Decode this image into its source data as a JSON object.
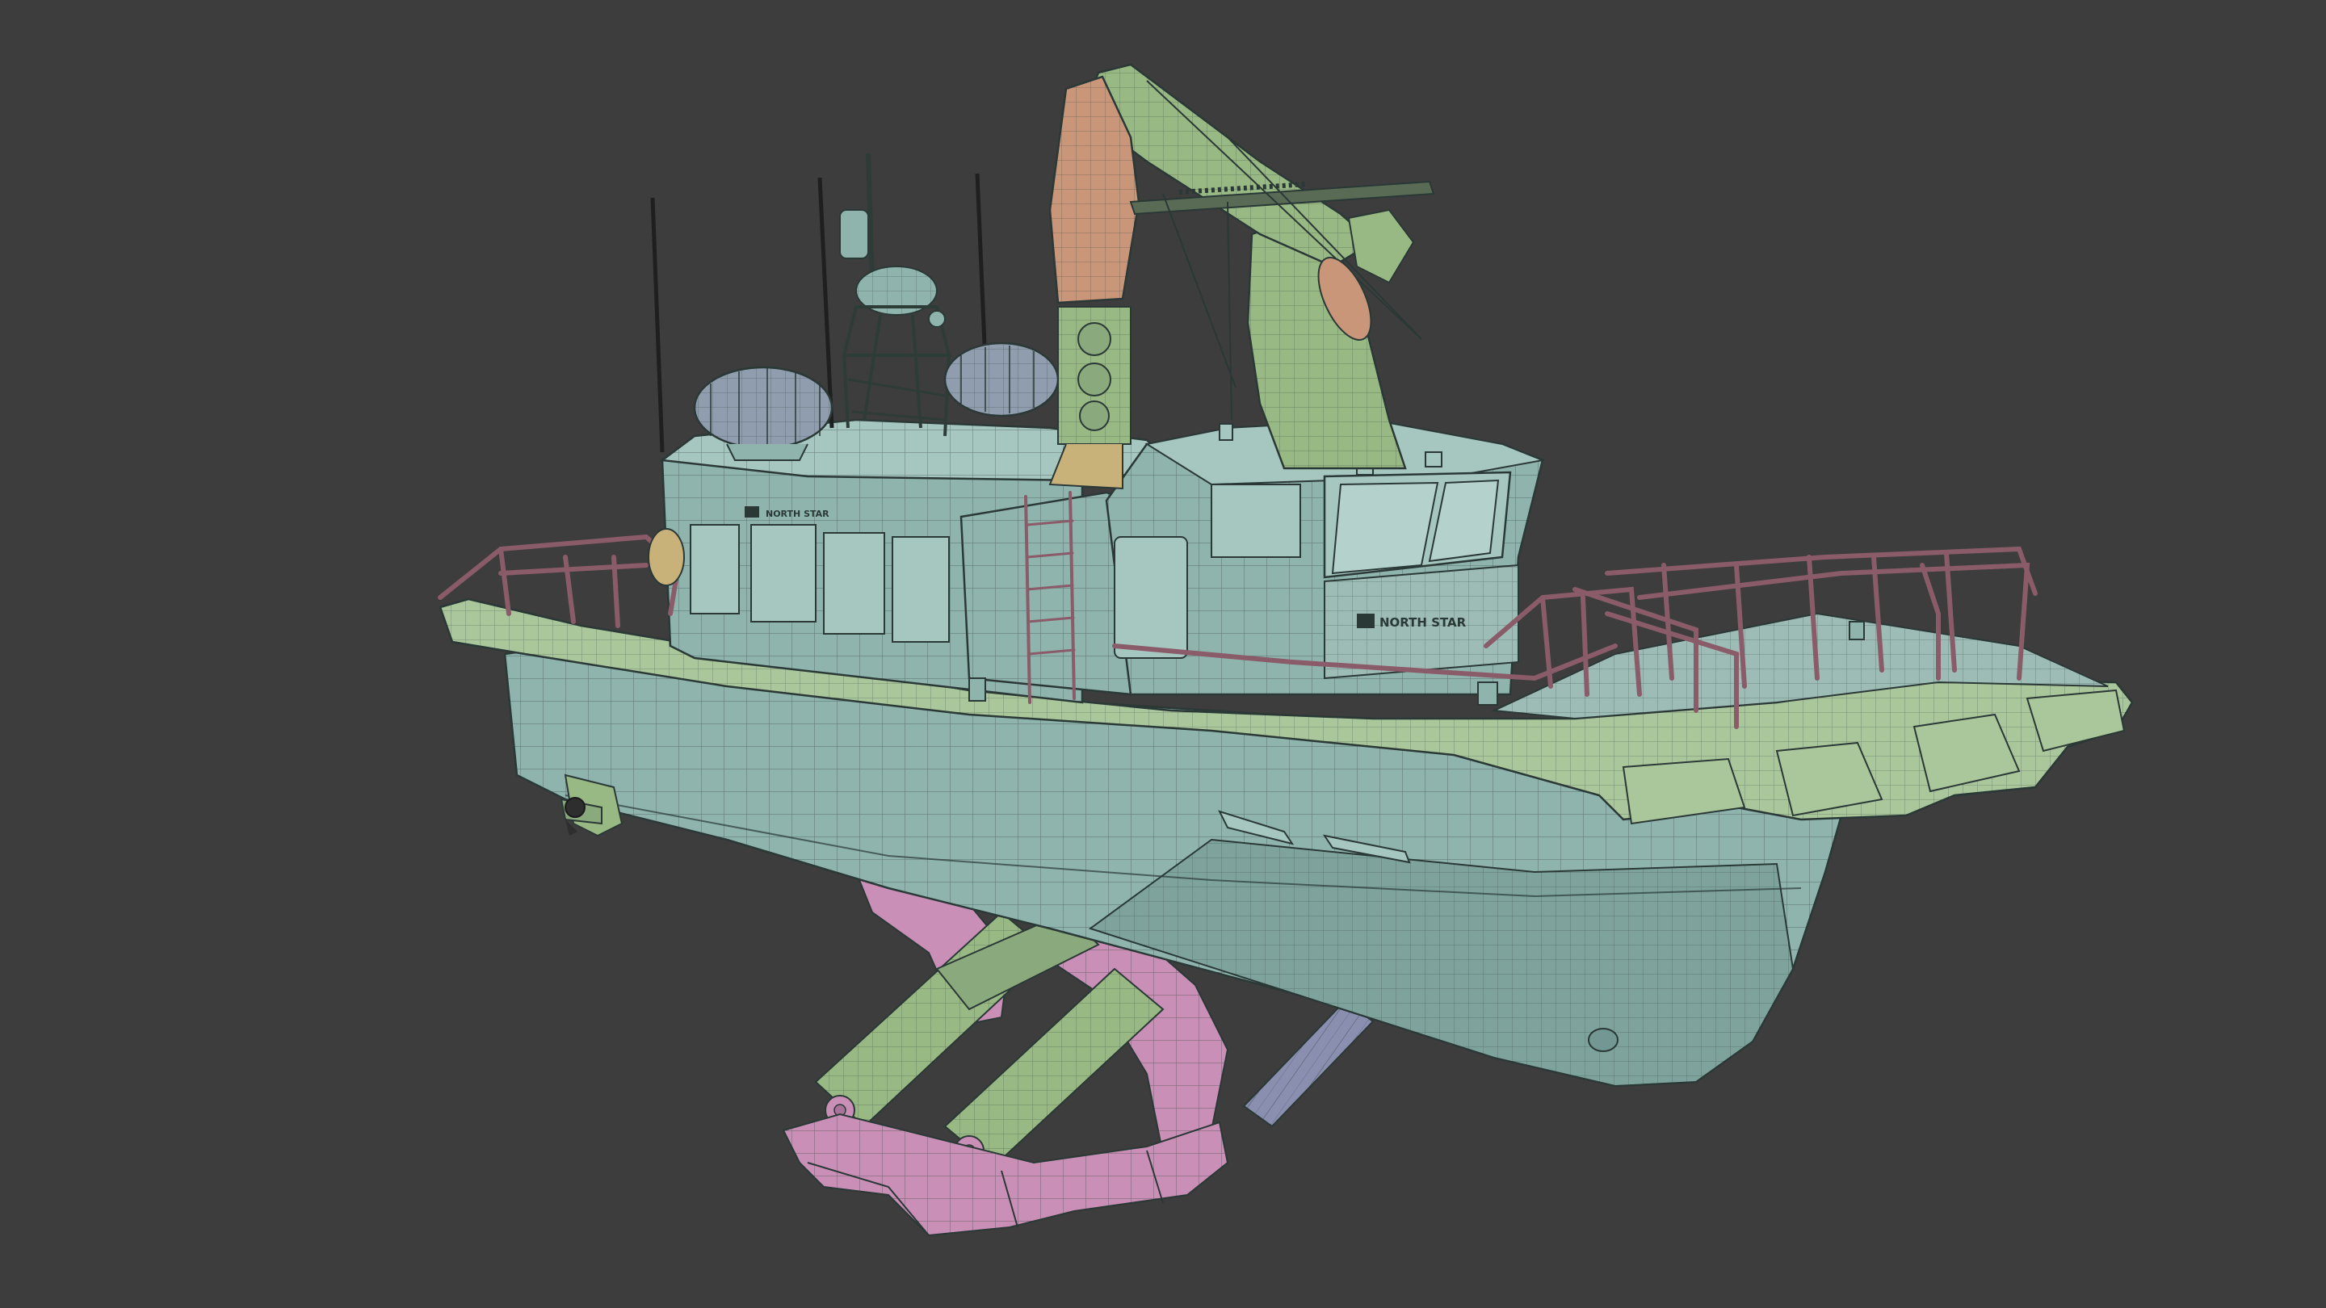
{
  "scene": {
    "background_color": "#3d3d3d",
    "wire_color": "#2a3836",
    "palette": {
      "hull": "#8fb4ae",
      "hull_dark": "#739893",
      "hull_light": "#a6c6c0",
      "fender": "#a9c79b",
      "fender_dark": "#8aa97d",
      "crane": "#98b983",
      "crane_dark": "#7a9967",
      "crane_boom_orange": "#c9967a",
      "cradle": "#c98fb7",
      "cradle_dark": "#a9739a",
      "railing": "#8a5b68",
      "cylinder": "#8a8fb0",
      "liferaft": "#8f9dae",
      "glass": "#5f7f7b"
    }
  },
  "vessel": {
    "brand_label_wheelhouse": "NORTH STAR",
    "brand_label_cabin": "NORTH STAR",
    "logo_icon": "north-star-logo-icon"
  }
}
